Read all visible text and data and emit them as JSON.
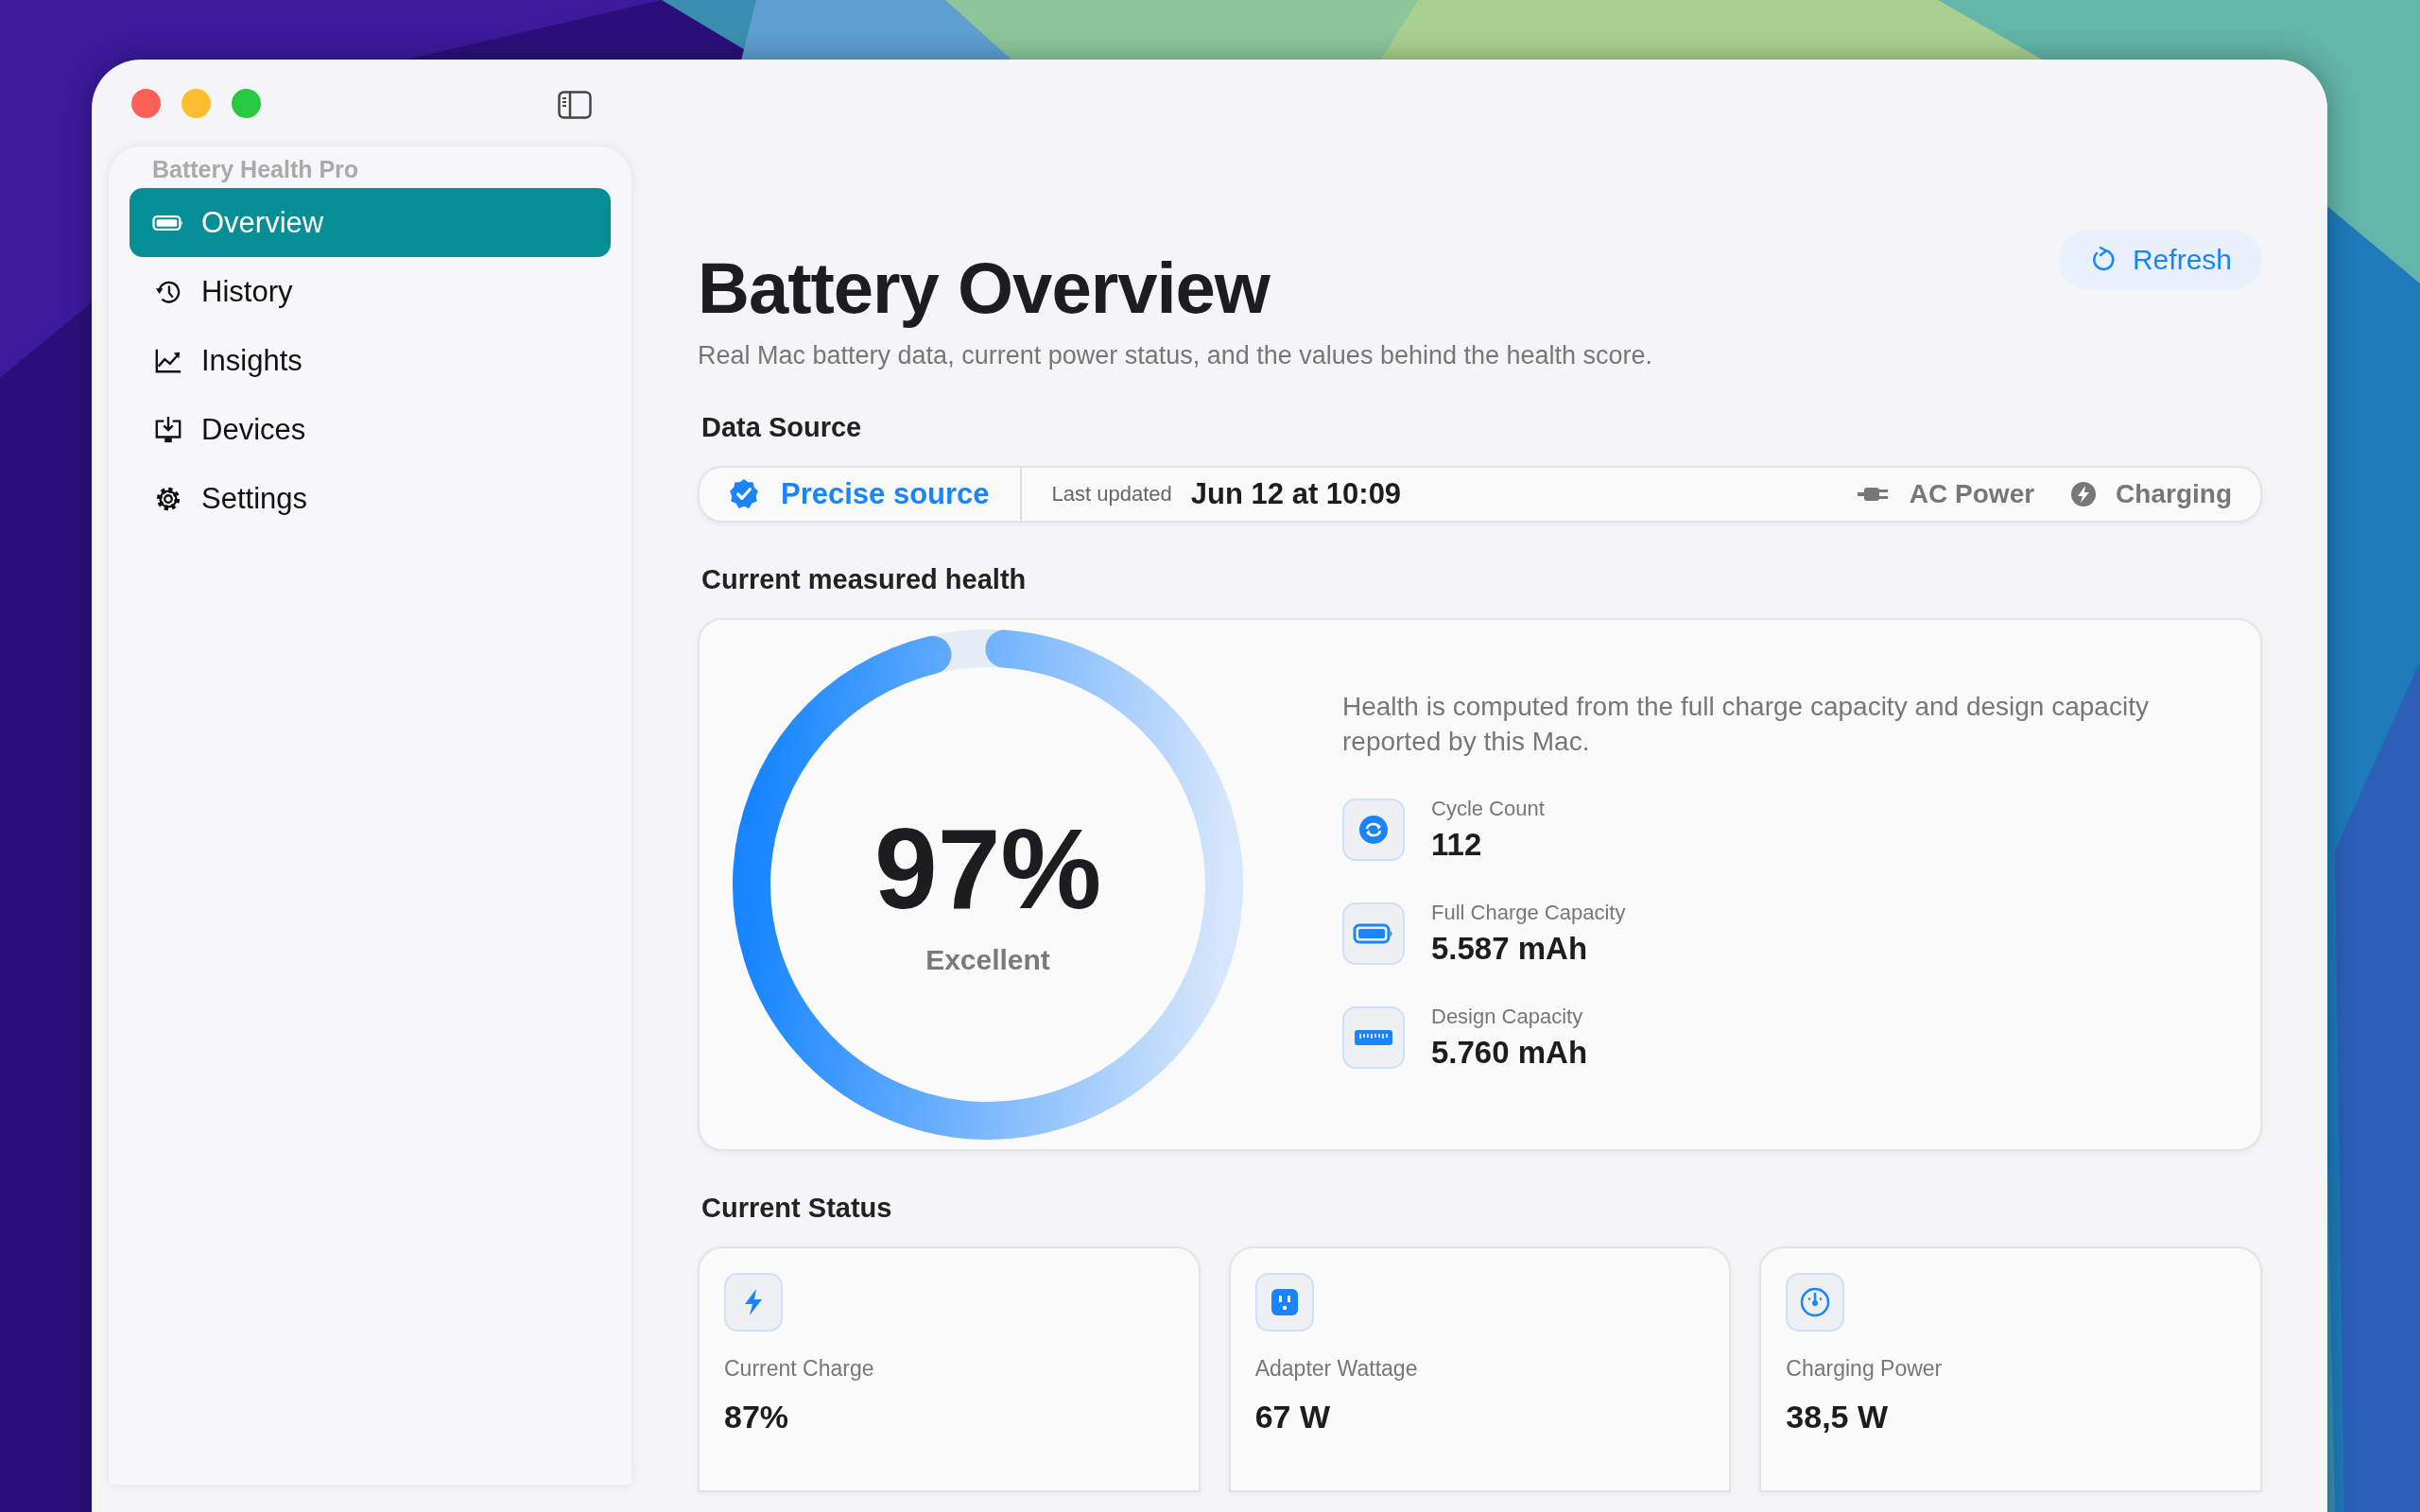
{
  "sidebar": {
    "app_name": "Battery Health Pro",
    "items": [
      {
        "label": "Overview",
        "selected": true
      },
      {
        "label": "History",
        "selected": false
      },
      {
        "label": "Insights",
        "selected": false
      },
      {
        "label": "Devices",
        "selected": false
      },
      {
        "label": "Settings",
        "selected": false
      }
    ]
  },
  "header": {
    "title": "Battery Overview",
    "subtitle": "Real Mac battery data, current power status, and the values behind the health score.",
    "refresh_button": "Refresh"
  },
  "data_source": {
    "heading": "Data Source",
    "source": "Precise source",
    "updated_label": "Last updated",
    "updated_value": "Jun 12 at 10:09",
    "power": "AC Power",
    "state": "Charging"
  },
  "health": {
    "heading": "Current measured health",
    "level": 0.97,
    "percent": "97%",
    "rating": "Excellent",
    "description": "Health is computed from the full charge capacity and design capacity reported by this Mac.",
    "metrics": [
      {
        "label": "Cycle Count",
        "value": "112"
      },
      {
        "label": "Full Charge Capacity",
        "value": "5.587 mAh"
      },
      {
        "label": "Design Capacity",
        "value": "5.760 mAh"
      }
    ]
  },
  "status": {
    "heading": "Current Status",
    "cards": [
      {
        "label": "Current Charge",
        "value": "87%"
      },
      {
        "label": "Adapter Wattage",
        "value": "67 W"
      },
      {
        "label": "Charging Power",
        "value": "38,5 W"
      }
    ]
  }
}
